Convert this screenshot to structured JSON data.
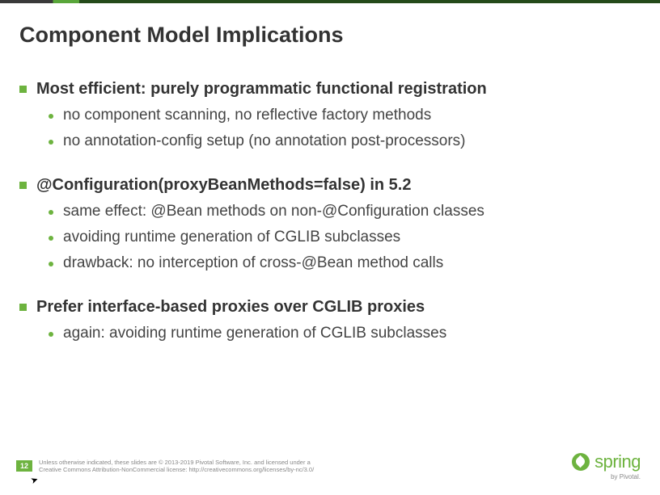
{
  "slide": {
    "title": "Component Model Implications",
    "sections": [
      {
        "heading": "Most efficient: purely programmatic functional registration",
        "items": [
          "no component scanning, no reflective factory methods",
          "no annotation-config setup (no annotation post-processors)"
        ]
      },
      {
        "heading": "@Configuration(proxyBeanMethods=false) in 5.2",
        "items": [
          "same effect: @Bean methods on non-@Configuration classes",
          "avoiding runtime generation of CGLIB subclasses",
          "drawback: no interception of cross-@Bean method calls"
        ]
      },
      {
        "heading": "Prefer interface-based proxies over CGLIB proxies",
        "items": [
          "again: avoiding runtime generation of CGLIB subclasses"
        ]
      }
    ],
    "page_number": "12",
    "footer_line1": "Unless otherwise indicated, these slides are © 2013-2019 Pivotal Software, Inc. and licensed under a",
    "footer_line2": "Creative Commons Attribution-NonCommercial license: http://creativecommons.org/licenses/by-nc/3.0/",
    "brand": "spring",
    "brand_sub": "by Pivotal."
  }
}
